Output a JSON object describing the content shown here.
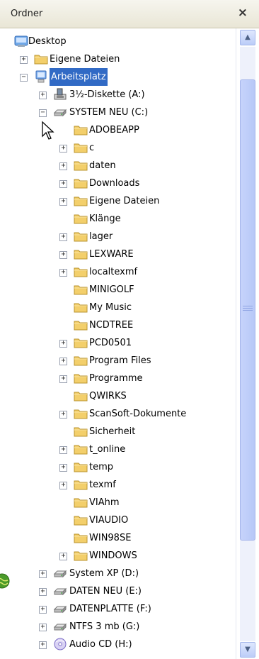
{
  "pane": {
    "title": "Ordner",
    "close_glyph": "×"
  },
  "tree": {
    "items": [
      {
        "label": "Desktop",
        "icon": "desktop-icon",
        "expander": ""
      },
      {
        "label": "Eigene Dateien",
        "icon": "folder-icon",
        "expander": "+"
      },
      {
        "label": "Arbeitsplatz",
        "icon": "computer-icon",
        "expander": "−",
        "selected": true
      },
      {
        "label": "3½-Diskette (A:)",
        "icon": "floppy-drive-icon",
        "expander": "+"
      },
      {
        "label": "SYSTEM NEU (C:)",
        "icon": "hard-drive-icon",
        "expander": "−"
      },
      {
        "label": "ADOBEAPP",
        "icon": "folder-icon",
        "expander": ""
      },
      {
        "label": "c",
        "icon": "folder-icon",
        "expander": "+"
      },
      {
        "label": "daten",
        "icon": "folder-icon",
        "expander": "+"
      },
      {
        "label": "Downloads",
        "icon": "folder-icon",
        "expander": "+"
      },
      {
        "label": "Eigene Dateien",
        "icon": "folder-icon",
        "expander": "+"
      },
      {
        "label": "Klänge",
        "icon": "folder-icon",
        "expander": ""
      },
      {
        "label": "lager",
        "icon": "folder-icon",
        "expander": "+"
      },
      {
        "label": "LEXWARE",
        "icon": "folder-icon",
        "expander": "+"
      },
      {
        "label": "localtexmf",
        "icon": "folder-icon",
        "expander": "+"
      },
      {
        "label": "MINIGOLF",
        "icon": "folder-icon",
        "expander": ""
      },
      {
        "label": "My Music",
        "icon": "folder-icon",
        "expander": ""
      },
      {
        "label": "NCDTREE",
        "icon": "folder-icon",
        "expander": ""
      },
      {
        "label": "PCD0501",
        "icon": "folder-icon",
        "expander": "+"
      },
      {
        "label": "Program Files",
        "icon": "folder-icon",
        "expander": "+"
      },
      {
        "label": "Programme",
        "icon": "folder-icon",
        "expander": "+"
      },
      {
        "label": "QWIRKS",
        "icon": "folder-icon",
        "expander": ""
      },
      {
        "label": "ScanSoft-Dokumente",
        "icon": "folder-icon",
        "expander": "+"
      },
      {
        "label": "Sicherheit",
        "icon": "folder-icon",
        "expander": ""
      },
      {
        "label": "t_online",
        "icon": "folder-icon",
        "expander": "+"
      },
      {
        "label": "temp",
        "icon": "folder-icon",
        "expander": "+"
      },
      {
        "label": "texmf",
        "icon": "folder-icon",
        "expander": "+"
      },
      {
        "label": "VIAhm",
        "icon": "folder-icon",
        "expander": ""
      },
      {
        "label": "VIAUDIO",
        "icon": "folder-icon",
        "expander": ""
      },
      {
        "label": "WIN98SE",
        "icon": "folder-icon",
        "expander": ""
      },
      {
        "label": "WINDOWS",
        "icon": "folder-icon",
        "expander": "+"
      },
      {
        "label": "System XP (D:)",
        "icon": "hard-drive-icon",
        "expander": "+"
      },
      {
        "label": "DATEN NEU (E:)",
        "icon": "hard-drive-icon",
        "expander": "+"
      },
      {
        "label": "DATENPLATTE (F:)",
        "icon": "hard-drive-icon",
        "expander": "+"
      },
      {
        "label": "NTFS 3 mb (G:)",
        "icon": "hard-drive-icon",
        "expander": "+"
      },
      {
        "label": "Audio CD (H:)",
        "icon": "cd-drive-icon",
        "expander": "+"
      }
    ]
  },
  "colors": {
    "selection": "#316ac5",
    "folder": "#f3cf6b",
    "scrollbar": "#c1d0fa"
  }
}
